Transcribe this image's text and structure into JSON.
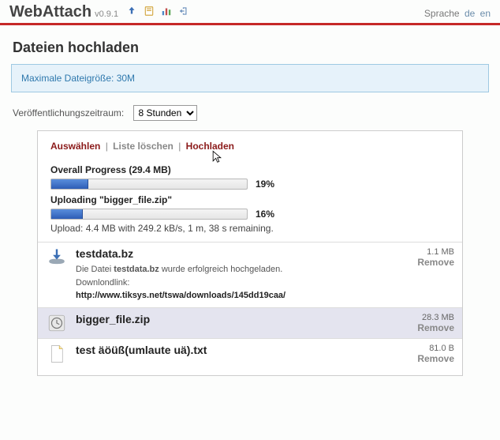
{
  "header": {
    "title": "WebAttach",
    "version": "v0.9.1",
    "lang_label": "Sprache",
    "lang_de": "de",
    "lang_en": "en"
  },
  "page": {
    "title": "Dateien hochladen",
    "info": "Maximale Dateigröße: 30M",
    "pub_label": "Veröffentlichungszeitraum:",
    "pub_selected": "8 Stunden"
  },
  "actions": {
    "select": "Auswählen",
    "clear": "Liste löschen",
    "upload": "Hochladen"
  },
  "progress": {
    "overall_label": "Overall Progress (29.4 MB)",
    "overall_pct": "19%",
    "overall_width": "19%",
    "current_label": "Uploading \"bigger_file.zip\"",
    "current_pct": "16%",
    "current_width": "16%",
    "detail": "Upload: 4.4 MB with 249.2 kB/s, 1 m, 38 s remaining."
  },
  "files": [
    {
      "name": "testdata.bz",
      "size": "1.1 MB",
      "remove": "Remove",
      "status": "done",
      "success_prefix": "Die Datei ",
      "success_fn": "testdata.bz",
      "success_suffix": " wurde erfolgreich hochgeladen.",
      "dl_label": "Downlondlink:",
      "dl_url": "http://www.tiksys.net/tswa/downloads/145dd19caa/"
    },
    {
      "name": "bigger_file.zip",
      "size": "28.3 MB",
      "remove": "Remove",
      "status": "uploading"
    },
    {
      "name": "test äöüß(umlaute uä).txt",
      "size": "81.0 B",
      "remove": "Remove",
      "status": "queued"
    }
  ]
}
